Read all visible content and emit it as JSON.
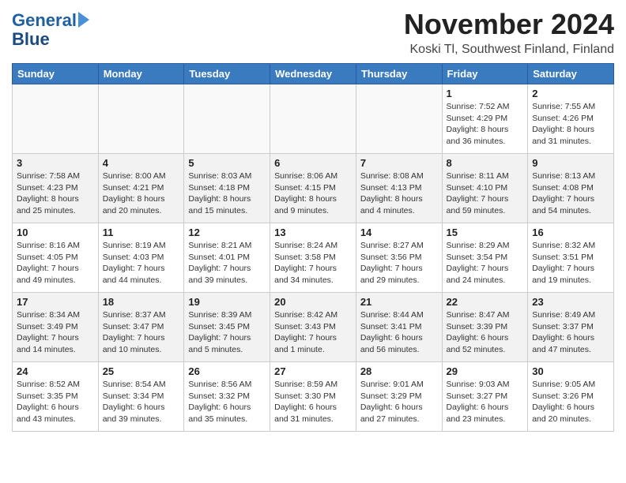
{
  "header": {
    "logo_line1": "General",
    "logo_line2": "Blue",
    "month_title": "November 2024",
    "location": "Koski Tl, Southwest Finland, Finland"
  },
  "days_of_week": [
    "Sunday",
    "Monday",
    "Tuesday",
    "Wednesday",
    "Thursday",
    "Friday",
    "Saturday"
  ],
  "weeks": [
    [
      {
        "day": "",
        "info": ""
      },
      {
        "day": "",
        "info": ""
      },
      {
        "day": "",
        "info": ""
      },
      {
        "day": "",
        "info": ""
      },
      {
        "day": "",
        "info": ""
      },
      {
        "day": "1",
        "info": "Sunrise: 7:52 AM\nSunset: 4:29 PM\nDaylight: 8 hours\nand 36 minutes."
      },
      {
        "day": "2",
        "info": "Sunrise: 7:55 AM\nSunset: 4:26 PM\nDaylight: 8 hours\nand 31 minutes."
      }
    ],
    [
      {
        "day": "3",
        "info": "Sunrise: 7:58 AM\nSunset: 4:23 PM\nDaylight: 8 hours\nand 25 minutes."
      },
      {
        "day": "4",
        "info": "Sunrise: 8:00 AM\nSunset: 4:21 PM\nDaylight: 8 hours\nand 20 minutes."
      },
      {
        "day": "5",
        "info": "Sunrise: 8:03 AM\nSunset: 4:18 PM\nDaylight: 8 hours\nand 15 minutes."
      },
      {
        "day": "6",
        "info": "Sunrise: 8:06 AM\nSunset: 4:15 PM\nDaylight: 8 hours\nand 9 minutes."
      },
      {
        "day": "7",
        "info": "Sunrise: 8:08 AM\nSunset: 4:13 PM\nDaylight: 8 hours\nand 4 minutes."
      },
      {
        "day": "8",
        "info": "Sunrise: 8:11 AM\nSunset: 4:10 PM\nDaylight: 7 hours\nand 59 minutes."
      },
      {
        "day": "9",
        "info": "Sunrise: 8:13 AM\nSunset: 4:08 PM\nDaylight: 7 hours\nand 54 minutes."
      }
    ],
    [
      {
        "day": "10",
        "info": "Sunrise: 8:16 AM\nSunset: 4:05 PM\nDaylight: 7 hours\nand 49 minutes."
      },
      {
        "day": "11",
        "info": "Sunrise: 8:19 AM\nSunset: 4:03 PM\nDaylight: 7 hours\nand 44 minutes."
      },
      {
        "day": "12",
        "info": "Sunrise: 8:21 AM\nSunset: 4:01 PM\nDaylight: 7 hours\nand 39 minutes."
      },
      {
        "day": "13",
        "info": "Sunrise: 8:24 AM\nSunset: 3:58 PM\nDaylight: 7 hours\nand 34 minutes."
      },
      {
        "day": "14",
        "info": "Sunrise: 8:27 AM\nSunset: 3:56 PM\nDaylight: 7 hours\nand 29 minutes."
      },
      {
        "day": "15",
        "info": "Sunrise: 8:29 AM\nSunset: 3:54 PM\nDaylight: 7 hours\nand 24 minutes."
      },
      {
        "day": "16",
        "info": "Sunrise: 8:32 AM\nSunset: 3:51 PM\nDaylight: 7 hours\nand 19 minutes."
      }
    ],
    [
      {
        "day": "17",
        "info": "Sunrise: 8:34 AM\nSunset: 3:49 PM\nDaylight: 7 hours\nand 14 minutes."
      },
      {
        "day": "18",
        "info": "Sunrise: 8:37 AM\nSunset: 3:47 PM\nDaylight: 7 hours\nand 10 minutes."
      },
      {
        "day": "19",
        "info": "Sunrise: 8:39 AM\nSunset: 3:45 PM\nDaylight: 7 hours\nand 5 minutes."
      },
      {
        "day": "20",
        "info": "Sunrise: 8:42 AM\nSunset: 3:43 PM\nDaylight: 7 hours\nand 1 minute."
      },
      {
        "day": "21",
        "info": "Sunrise: 8:44 AM\nSunset: 3:41 PM\nDaylight: 6 hours\nand 56 minutes."
      },
      {
        "day": "22",
        "info": "Sunrise: 8:47 AM\nSunset: 3:39 PM\nDaylight: 6 hours\nand 52 minutes."
      },
      {
        "day": "23",
        "info": "Sunrise: 8:49 AM\nSunset: 3:37 PM\nDaylight: 6 hours\nand 47 minutes."
      }
    ],
    [
      {
        "day": "24",
        "info": "Sunrise: 8:52 AM\nSunset: 3:35 PM\nDaylight: 6 hours\nand 43 minutes."
      },
      {
        "day": "25",
        "info": "Sunrise: 8:54 AM\nSunset: 3:34 PM\nDaylight: 6 hours\nand 39 minutes."
      },
      {
        "day": "26",
        "info": "Sunrise: 8:56 AM\nSunset: 3:32 PM\nDaylight: 6 hours\nand 35 minutes."
      },
      {
        "day": "27",
        "info": "Sunrise: 8:59 AM\nSunset: 3:30 PM\nDaylight: 6 hours\nand 31 minutes."
      },
      {
        "day": "28",
        "info": "Sunrise: 9:01 AM\nSunset: 3:29 PM\nDaylight: 6 hours\nand 27 minutes."
      },
      {
        "day": "29",
        "info": "Sunrise: 9:03 AM\nSunset: 3:27 PM\nDaylight: 6 hours\nand 23 minutes."
      },
      {
        "day": "30",
        "info": "Sunrise: 9:05 AM\nSunset: 3:26 PM\nDaylight: 6 hours\nand 20 minutes."
      }
    ]
  ]
}
